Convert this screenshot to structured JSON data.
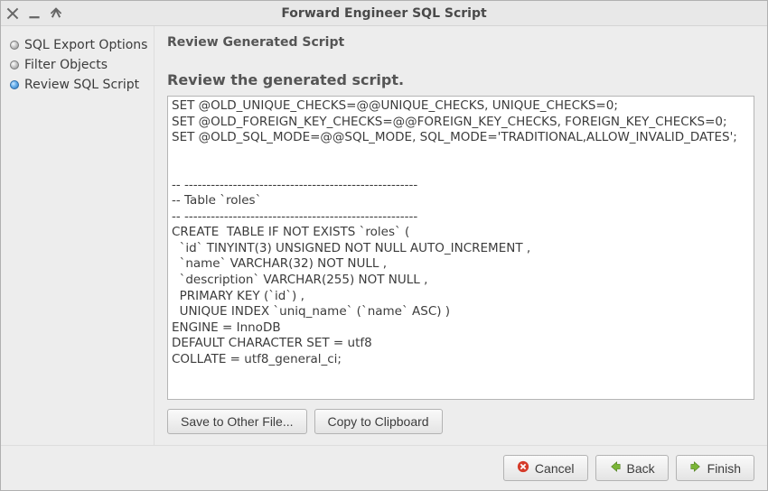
{
  "window": {
    "title": "Forward Engineer SQL Script"
  },
  "sidebar": {
    "steps": [
      {
        "label": "SQL Export Options",
        "active": false
      },
      {
        "label": "Filter Objects",
        "active": false
      },
      {
        "label": "Review SQL Script",
        "active": true
      }
    ]
  },
  "content": {
    "heading": "Review Generated Script",
    "subheading": "Review the generated script.",
    "script": "SET @OLD_UNIQUE_CHECKS=@@UNIQUE_CHECKS, UNIQUE_CHECKS=0;\nSET @OLD_FOREIGN_KEY_CHECKS=@@FOREIGN_KEY_CHECKS, FOREIGN_KEY_CHECKS=0;\nSET @OLD_SQL_MODE=@@SQL_MODE, SQL_MODE='TRADITIONAL,ALLOW_INVALID_DATES';\n\n\n-- -----------------------------------------------------\n-- Table `roles`\n-- -----------------------------------------------------\nCREATE  TABLE IF NOT EXISTS `roles` (\n  `id` TINYINT(3) UNSIGNED NOT NULL AUTO_INCREMENT ,\n  `name` VARCHAR(32) NOT NULL ,\n  `description` VARCHAR(255) NOT NULL ,\n  PRIMARY KEY (`id`) ,\n  UNIQUE INDEX `uniq_name` (`name` ASC) )\nENGINE = InnoDB\nDEFAULT CHARACTER SET = utf8\nCOLLATE = utf8_general_ci;\n"
  },
  "buttons": {
    "save_to_file": "Save to Other File...",
    "copy_clipboard": "Copy to Clipboard",
    "cancel": "Cancel",
    "back": "Back",
    "finish": "Finish"
  }
}
